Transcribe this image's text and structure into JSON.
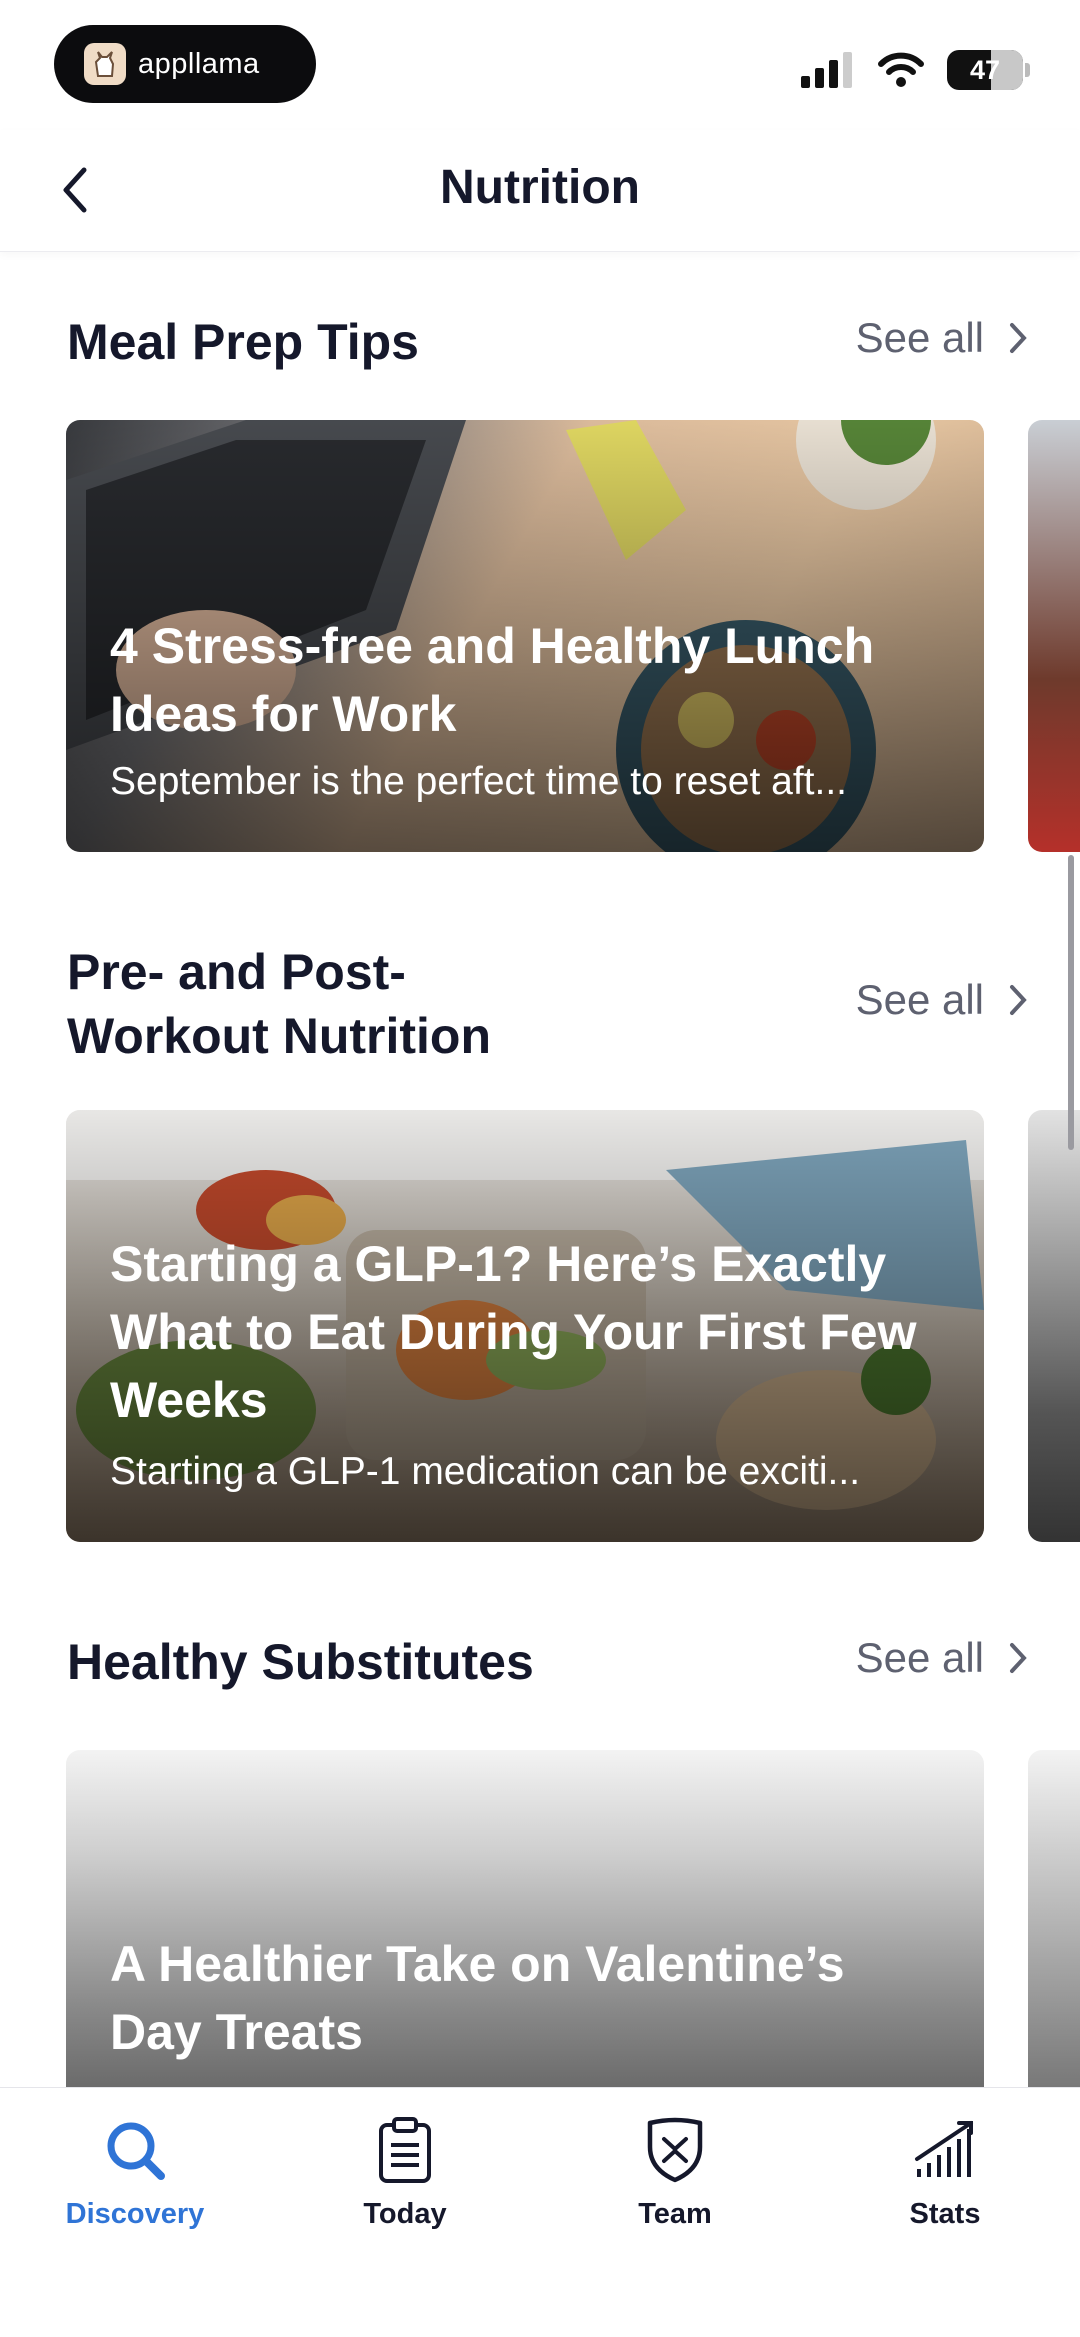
{
  "status_bar": {
    "app_name": "appllama",
    "battery": "47"
  },
  "header": {
    "title": "Nutrition"
  },
  "sections": [
    {
      "title": "Meal Prep Tips",
      "see_all": "See all",
      "card": {
        "title": "4 Stress-free and Healthy Lunch Ideas for Work",
        "subtitle": "September is the perfect time to reset aft..."
      }
    },
    {
      "title": "Pre- and Post-Workout Nutrition",
      "see_all": "See all",
      "card": {
        "title": "Starting a GLP-1? Here’s Exactly What to Eat During Your First Few Weeks",
        "subtitle": "Starting a GLP-1 medication can be exciti..."
      }
    },
    {
      "title": "Healthy Substitutes",
      "see_all": "See all",
      "card": {
        "title": "A Healthier Take on Valentine’s Day Treats",
        "subtitle": ""
      }
    }
  ],
  "tabs": [
    {
      "label": "Discovery",
      "icon": "search-icon",
      "active": true
    },
    {
      "label": "Today",
      "icon": "clipboard-icon",
      "active": false
    },
    {
      "label": "Team",
      "icon": "shield-icon",
      "active": false
    },
    {
      "label": "Stats",
      "icon": "bar-chart-icon",
      "active": false
    }
  ],
  "colors": {
    "accent": "#2f74d6",
    "text": "#15182b",
    "muted": "#5e6170"
  }
}
